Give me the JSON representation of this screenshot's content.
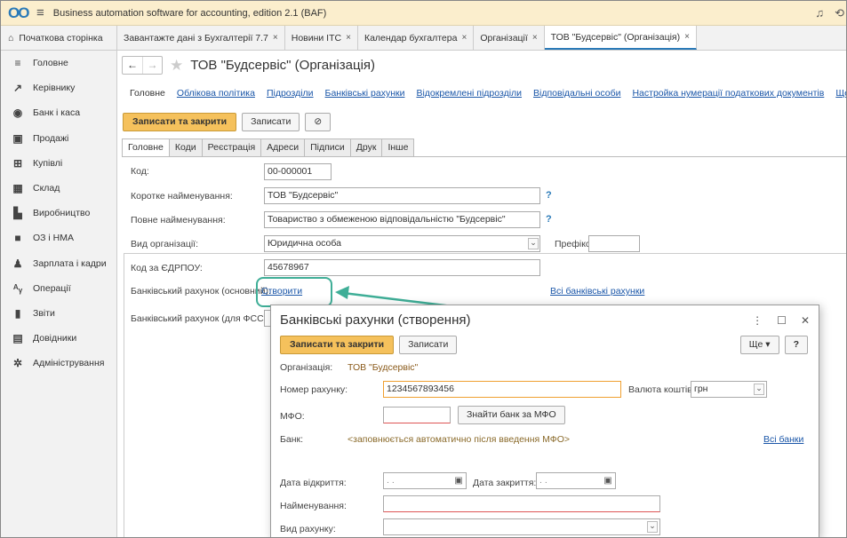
{
  "app": {
    "logo": "ОО",
    "title": "Business automation software for accounting, edition 2.1  (BAF)"
  },
  "tabs": {
    "home": "Початкова сторінка",
    "items": [
      {
        "label": "Завантажте дані з Бухгалтерії 7.7"
      },
      {
        "label": "Новини ІТС"
      },
      {
        "label": "Календар бухгалтера"
      },
      {
        "label": "Організації"
      },
      {
        "label": "ТОВ \"Будсервіс\" (Організація)"
      }
    ],
    "close": "×"
  },
  "sidebar": {
    "items": [
      {
        "label": "Головне",
        "icon": "≡"
      },
      {
        "label": "Керівнику",
        "icon": "↗"
      },
      {
        "label": "Банк і каса",
        "icon": "◉"
      },
      {
        "label": "Продажі",
        "icon": "▣"
      },
      {
        "label": "Купівлі",
        "icon": "⊞"
      },
      {
        "label": "Склад",
        "icon": "▦"
      },
      {
        "label": "Виробництво",
        "icon": "▙"
      },
      {
        "label": "ОЗ і НМА",
        "icon": "■"
      },
      {
        "label": "Зарплата і кадри",
        "icon": "♟"
      },
      {
        "label": "Операції",
        "icon": "ᴬᵧ"
      },
      {
        "label": "Звіти",
        "icon": "▮"
      },
      {
        "label": "Довідники",
        "icon": "▤"
      },
      {
        "label": "Адміністрування",
        "icon": "✲"
      }
    ]
  },
  "form": {
    "title": "ТОВ \"Будсервіс\" (Організація)",
    "nav_links": [
      {
        "label": "Головне"
      },
      {
        "label": "Облікова політика"
      },
      {
        "label": "Підрозділи"
      },
      {
        "label": "Банківські рахунки"
      },
      {
        "label": "Відокремлені підрозділи"
      },
      {
        "label": "Відповідальні особи"
      },
      {
        "label": "Настройка нумерації податкових документів"
      },
      {
        "label": "Ще... ▾"
      }
    ],
    "save_close": "Записати та закрити",
    "save": "Записати",
    "tabs": [
      {
        "label": "Головне"
      },
      {
        "label": "Коди"
      },
      {
        "label": "Реєстрація"
      },
      {
        "label": "Адреси"
      },
      {
        "label": "Підписи"
      },
      {
        "label": "Друк"
      },
      {
        "label": "Інше"
      }
    ],
    "fields": {
      "code_label": "Код:",
      "code_value": "00-000001",
      "short_name_label": "Коротке найменування:",
      "short_name_value": "ТОВ \"Будсервіс\"",
      "full_name_label": "Повне найменування:",
      "full_name_value": "Товариство з обмеженою відповідальністю \"Будсервіс\"",
      "org_type_label": "Вид організації:",
      "org_type_value": "Юридична особа",
      "prefix_label": "Префікс:",
      "prefix_value": "",
      "edrpou_label": "Код за ЄДРПОУ:",
      "edrpou_value": "45678967",
      "bank_main_label": "Банківський рахунок (основний):",
      "bank_main_link": "Створити",
      "all_accounts_link": "Всі банківські рахунки",
      "bank_fss_label": "Банківський рахунок (для ФСС):",
      "help": "?"
    }
  },
  "dialog": {
    "title": "Банківські рахунки (створення)",
    "more_label": "Ще ▾",
    "help_label": "?",
    "save_close": "Записати та закрити",
    "save": "Записати",
    "org_label": "Організація:",
    "org_value": "ТОВ \"Будсервіс\"",
    "account_label": "Номер рахунку:",
    "account_value": "1234567893456",
    "currency_label": "Валюта коштів:",
    "currency_value": "грн",
    "mfo_label": "МФО:",
    "mfo_value": "",
    "find_bank": "Знайти банк за МФО",
    "bank_label": "Банк:",
    "bank_hint": "<заповнюється автоматично після введення МФО>",
    "all_banks": "Всі банки",
    "open_date_label": "Дата відкриття:",
    "open_date_value": " .  .",
    "close_date_label": "Дата закриття:",
    "close_date_value": " .  .",
    "name_label": "Найменування:",
    "name_value": "",
    "type_label": "Вид рахунку:",
    "type_value": ""
  },
  "colors": {
    "accent": "#f5c15c",
    "link": "#1a56a8",
    "highlight": "#3fae97",
    "titlebar": "#fbeecd"
  }
}
